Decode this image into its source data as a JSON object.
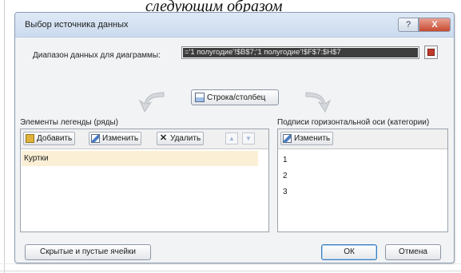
{
  "top_text": "следующим образом",
  "dialog": {
    "title": "Выбор источника данных",
    "help_label": "?",
    "close_label": "X",
    "range_label": "Диапазон данных для диаграммы:",
    "range_value": "='1 полугодие'!$B$7;'1 полугодие'!$F$7:$H$7",
    "switch_label": "Строка/столбец",
    "legend": {
      "label": "Элементы легенды (ряды)",
      "add_label": "Добавить",
      "edit_label": "Изменить",
      "delete_label": "Удалить",
      "up_icon": "▲",
      "down_icon": "▼",
      "items": [
        "Куртки"
      ]
    },
    "axis": {
      "label": "Подписи горизонтальной оси (категории)",
      "edit_label": "Изменить",
      "items": [
        "1",
        "2",
        "3"
      ]
    },
    "hidden_cells_label": "Скрытые и пустые ячейки",
    "ok_label": "ОК",
    "cancel_label": "Отмена"
  },
  "colors": {
    "selection": "#fbf0d5",
    "close_button": "#c74a30",
    "title_bar": "#cbdbee"
  }
}
